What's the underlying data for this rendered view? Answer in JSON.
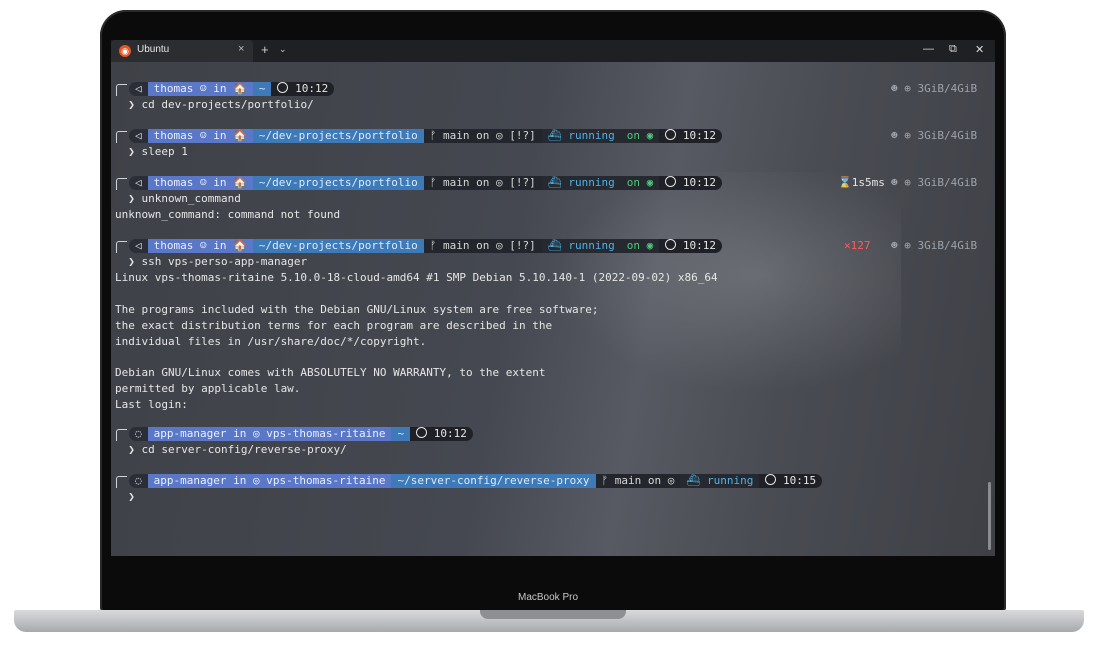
{
  "window": {
    "tab_title": "Ubuntu",
    "tab_close": "×",
    "new_tab": "+",
    "tab_dropdown": "⌄",
    "minimize": "—",
    "maximize": "⧉",
    "close": "✕",
    "brand": "MacBook Pro"
  },
  "colors": {
    "user_segment": "#5b78c8",
    "path_segment": "#3e79b8",
    "docker": "#4fb2e6",
    "node": "#4ec77a",
    "error": "#ff5a5f"
  },
  "prompts": [
    {
      "user": "thomas",
      "in": "in",
      "home": "🏠",
      "path": "~",
      "time": "10:12",
      "command": "cd dev-projects/portfolio/",
      "mem": "3GiB/4GiB"
    },
    {
      "user": "thomas",
      "in": "in",
      "home": "🏠",
      "path": "~/dev-projects/portfolio",
      "branch": "main",
      "on": "on",
      "status": "[!?]",
      "docker": "running",
      "node_on": "on",
      "time": "10:12",
      "command": "sleep 1",
      "mem": "3GiB/4GiB"
    },
    {
      "user": "thomas",
      "in": "in",
      "home": "🏠",
      "path": "~/dev-projects/portfolio",
      "branch": "main",
      "on": "on",
      "status": "[!?]",
      "docker": "running",
      "node_on": "on",
      "time": "10:12",
      "command": "unknown_command",
      "duration": "1s5ms",
      "mem": "3GiB/4GiB"
    },
    {
      "user": "thomas",
      "in": "in",
      "home": "🏠",
      "path": "~/dev-projects/portfolio",
      "branch": "main",
      "on": "on",
      "status": "[!?]",
      "docker": "running",
      "node_on": "on",
      "time": "10:12",
      "command": "ssh vps-perso-app-manager",
      "exit_code": "127",
      "mem": "3GiB/4GiB"
    },
    {
      "user": "app-manager",
      "in": "in",
      "host": "vps-thomas-ritaine",
      "path": "~",
      "time": "10:12",
      "command": "cd server-config/reverse-proxy/"
    },
    {
      "user": "app-manager",
      "in": "in",
      "host": "vps-thomas-ritaine",
      "path": "~/server-config/reverse-proxy",
      "branch": "main",
      "on": "on",
      "docker": "running",
      "time": "10:15",
      "command": ""
    }
  ],
  "output": {
    "unknown": "unknown_command: command not found",
    "ssh": [
      "Linux vps-thomas-ritaine 5.10.0-18-cloud-amd64 #1 SMP Debian 5.10.140-1 (2022-09-02) x86_64",
      "",
      "The programs included with the Debian GNU/Linux system are free software;",
      "the exact distribution terms for each program are described in the",
      "individual files in /usr/share/doc/*/copyright.",
      "",
      "Debian GNU/Linux comes with ABSOLUTELY NO WARRANTY, to the extent",
      "permitted by applicable law.",
      "Last login:"
    ]
  },
  "icons": {
    "os": "megaphone-icon",
    "home": "home-icon",
    "branch": "git-branch-icon",
    "github": "github-icon",
    "docker": "docker-icon",
    "clock": "clock-icon",
    "memory": "memory-icon",
    "node": "node-icon",
    "debian": "debian-icon",
    "hourglass": "hourglass-icon"
  }
}
